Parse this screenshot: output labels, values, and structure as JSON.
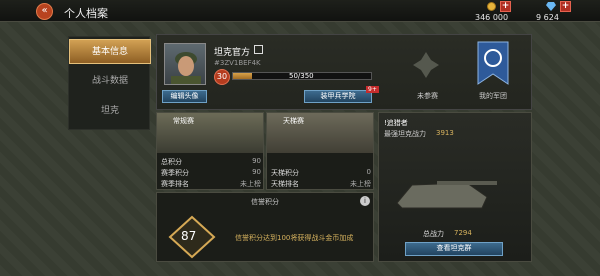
{
  "header": {
    "title": "个人档案",
    "back_icon": "chevron-double-left-icon",
    "gold": "346 000",
    "gems": "9 624"
  },
  "nav": [
    "基本信息",
    "战斗数据",
    "坦克"
  ],
  "profile": {
    "name": "坦克官方",
    "id": "#3ZV1BEF4K",
    "level": "30",
    "xp": "50/350",
    "xp_fraction": 0.14,
    "edit_avatar": "编辑头像",
    "academy": "装甲兵学院",
    "academy_badge": "9+",
    "not_joined": "未参赛",
    "my_legion": "我的军团"
  },
  "regular": {
    "title": "常规赛",
    "rows": [
      {
        "k": "总积分",
        "v": "90"
      },
      {
        "k": "赛季积分",
        "v": "90"
      },
      {
        "k": "赛季排名",
        "v": "未上榜"
      }
    ]
  },
  "ladder": {
    "title": "天梯赛",
    "rows": [
      {
        "k": "天梯积分",
        "v": "0"
      },
      {
        "k": "天梯排名",
        "v": "未上榜"
      }
    ]
  },
  "reputation": {
    "title": "信誉积分",
    "value": "87",
    "desc": "信誉积分达到100将获得战斗金币加成"
  },
  "tank": {
    "name": "!追猎者",
    "sub": "最强坦克战力",
    "sub_val": "3913",
    "power_label": "总战力",
    "power": "7294",
    "button": "查看坦克群"
  }
}
